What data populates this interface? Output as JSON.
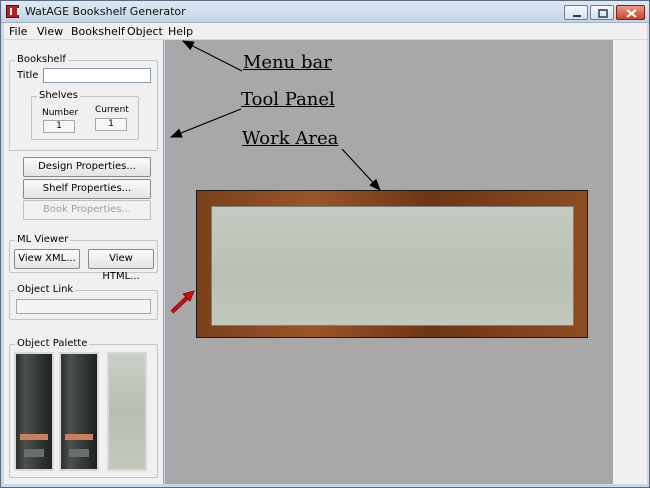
{
  "window": {
    "title": "WatAGE Bookshelf Generator",
    "controls": [
      "minimize-icon",
      "maximize-icon",
      "close-icon"
    ]
  },
  "menu": {
    "items": [
      "File",
      "View",
      "Bookshelf",
      "Object",
      "Help"
    ]
  },
  "toolpanel": {
    "bookshelf": {
      "legend": "Bookshelf",
      "title_label": "Title",
      "title_value": "",
      "shelves": {
        "legend": "Shelves",
        "number_label": "Number",
        "number_value": "1",
        "current_label": "Current",
        "current_value": "1"
      }
    },
    "buttons": {
      "design": "Design Properties...",
      "shelf": "Shelf Properties...",
      "book": "Book Properties..."
    },
    "ml_viewer": {
      "legend": "ML Viewer",
      "view_xml": "View XML...",
      "view_html": "View HTML..."
    },
    "object_link": {
      "legend": "Object Link",
      "value": ""
    },
    "object_palette": {
      "legend": "Object Palette",
      "tiles": [
        "binder",
        "binder",
        "panel"
      ]
    }
  },
  "annotations": {
    "menu_bar": "Menu bar",
    "tool_panel": "Tool Panel",
    "work_area": "Work Area"
  },
  "colors": {
    "work_area_bg": "#a8a8a8",
    "shelf_wood": "#8e4d22",
    "arrow_red": "#d01010"
  }
}
